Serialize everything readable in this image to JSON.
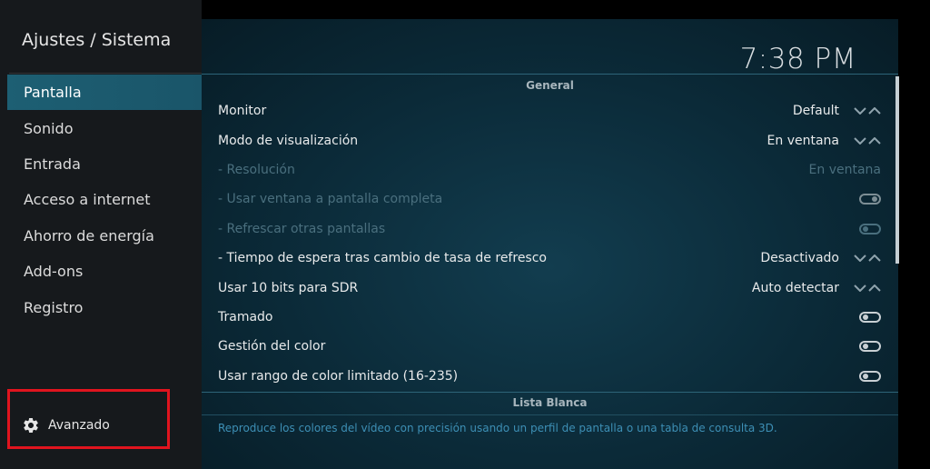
{
  "sidebar": {
    "title": "Ajustes / Sistema",
    "items": [
      {
        "label": "Pantalla",
        "active": true
      },
      {
        "label": "Sonido"
      },
      {
        "label": "Entrada"
      },
      {
        "label": "Acceso a internet"
      },
      {
        "label": "Ahorro de energía"
      },
      {
        "label": "Add-ons"
      },
      {
        "label": "Registro"
      }
    ],
    "advanced_label": "Avanzado",
    "advanced_icon": "gear-icon"
  },
  "header": {
    "clock": "7:38 PM"
  },
  "sections": {
    "general": "General",
    "whitelist": "Lista Blanca"
  },
  "settings": {
    "monitor": {
      "label": "Monitor",
      "value": "Default"
    },
    "display_mode": {
      "label": "Modo de visualización",
      "value": "En ventana"
    },
    "resolution": {
      "label": "- Resolución",
      "value": "En ventana"
    },
    "fullscreen_window": {
      "label": "- Usar ventana a pantalla completa",
      "state": "on"
    },
    "blank_displays": {
      "label": "- Refrescar otras pantallas",
      "state": "off"
    },
    "refresh_delay": {
      "label": "- Tiempo de espera tras cambio de tasa de refresco",
      "value": "Desactivado"
    },
    "ten_bit_sdr": {
      "label": "Usar 10 bits para SDR",
      "value": "Auto detectar"
    },
    "dithering": {
      "label": "Tramado",
      "state": "off"
    },
    "color_management": {
      "label": "Gestión del color",
      "state": "off"
    },
    "limited_range": {
      "label": "Usar rango de color limitado (16-235)",
      "state": "off"
    }
  },
  "description": "Reproduce los colores del vídeo con precisión usando un perfil de pantalla o una tabla de consulta 3D.",
  "colors": {
    "accent": "#1d5f73",
    "highlight_border": "#e0141e",
    "description_text": "#3d8fb5"
  }
}
